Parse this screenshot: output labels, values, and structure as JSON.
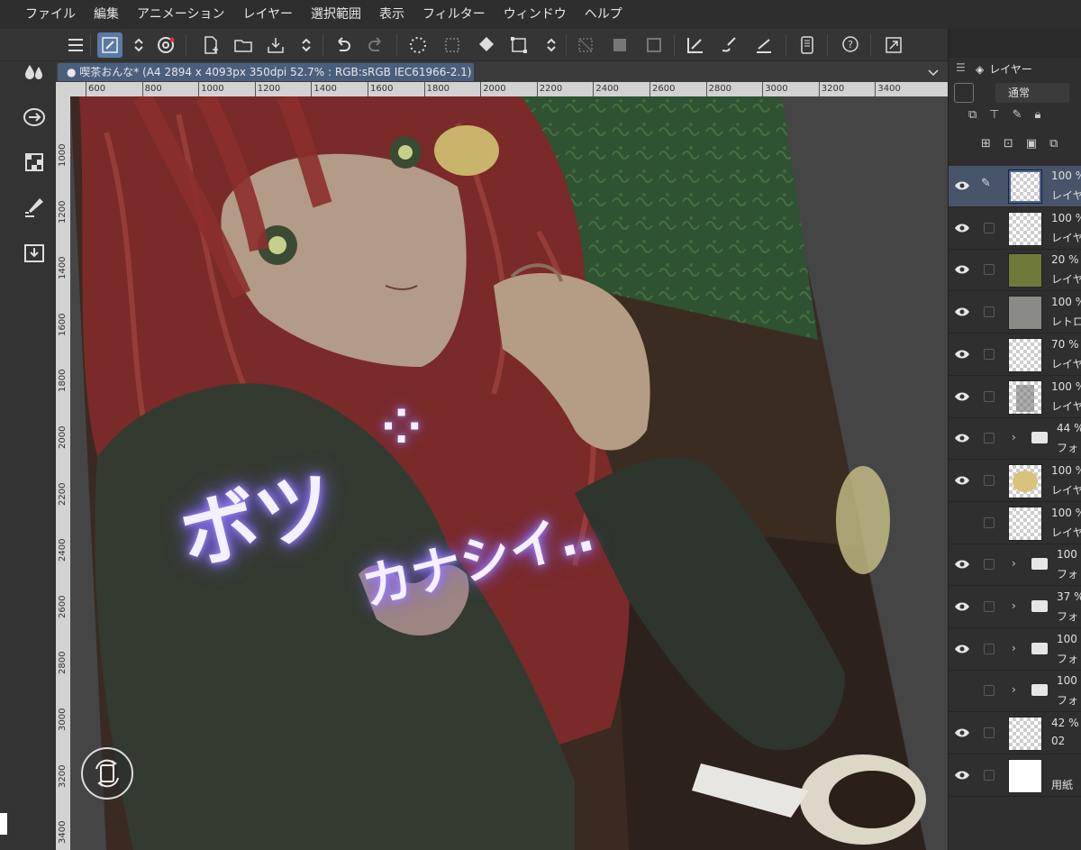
{
  "menu": [
    "ファイル",
    "編集",
    "アニメーション",
    "レイヤー",
    "選択範囲",
    "表示",
    "フィルター",
    "ウィンドウ",
    "ヘルプ"
  ],
  "document_tab": {
    "title": "喫茶おんな* (A4 2894 x 4093px 350dpi 52.7% : RGB:sRGB IEC61966-2.1)"
  },
  "ruler_h": [
    "600",
    "800",
    "1000",
    "1200",
    "1400",
    "1600",
    "1800",
    "2000",
    "2200",
    "2400",
    "2600",
    "2800",
    "3000",
    "3200",
    "3400"
  ],
  "ruler_v": [
    "1000",
    "1200",
    "1400",
    "1600",
    "1800",
    "2000",
    "2200",
    "2400",
    "2600",
    "2800",
    "3000",
    "3200",
    "3400"
  ],
  "canvas": {
    "text_line1": "ボツ",
    "text_line2": "カナシイ‥"
  },
  "layer_panel": {
    "tab_label": "レイヤー",
    "blend_mode": "通常",
    "layers": [
      {
        "opacity": "100 %",
        "name": "レイヤ",
        "visible": true,
        "selected": true,
        "thumb": "checker-lilac"
      },
      {
        "opacity": "100 %",
        "name": "レイヤ",
        "visible": true,
        "selected": false,
        "thumb": "checker"
      },
      {
        "opacity": "20 %",
        "name": "レイヤ",
        "visible": true,
        "selected": false,
        "thumb": "olive"
      },
      {
        "opacity": "100 %",
        "name": "レトロ",
        "visible": true,
        "selected": false,
        "thumb": "gray"
      },
      {
        "opacity": "70 %",
        "name": "レイヤ",
        "visible": true,
        "selected": false,
        "thumb": "checker"
      },
      {
        "opacity": "100 %",
        "name": "レイヤ",
        "visible": true,
        "selected": false,
        "thumb": "sketch"
      },
      {
        "opacity": "44 %",
        "name": "フォ",
        "visible": true,
        "selected": false,
        "thumb": "folder"
      },
      {
        "opacity": "100 %",
        "name": "レイヤ",
        "visible": true,
        "selected": false,
        "thumb": "yellow"
      },
      {
        "opacity": "100 %",
        "name": "レイヤ",
        "visible": false,
        "selected": false,
        "thumb": "checker"
      },
      {
        "opacity": "100 %",
        "name": "フォ",
        "visible": true,
        "selected": false,
        "thumb": "folder"
      },
      {
        "opacity": "37 %",
        "name": "フォ",
        "visible": true,
        "selected": false,
        "thumb": "folder"
      },
      {
        "opacity": "100 %",
        "name": "フォ",
        "visible": true,
        "selected": false,
        "thumb": "folder"
      },
      {
        "opacity": "100 %",
        "name": "フォ",
        "visible": false,
        "selected": false,
        "thumb": "folder"
      },
      {
        "opacity": "42 %",
        "name": "02",
        "visible": true,
        "selected": false,
        "thumb": "checker"
      },
      {
        "opacity": "",
        "name": "用紙",
        "visible": true,
        "selected": false,
        "thumb": "white"
      }
    ]
  },
  "colors": {
    "selection": "#47546a",
    "tab": "#4a5f7e",
    "glow_text": "#a58cff"
  }
}
